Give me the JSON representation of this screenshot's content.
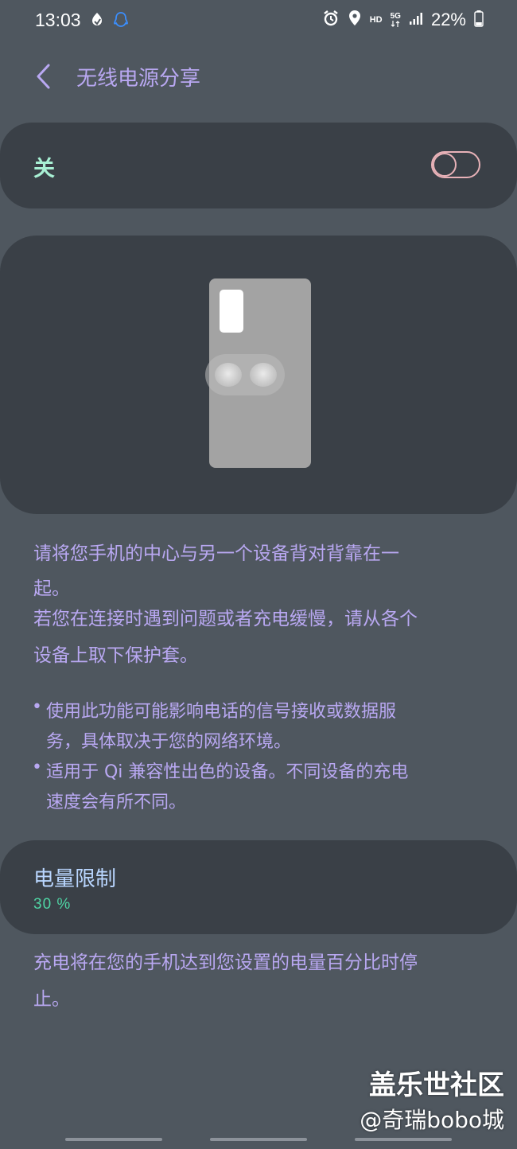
{
  "status_bar": {
    "time": "13:03",
    "left_icons": [
      "bixby-routine-icon",
      "qq-icon"
    ],
    "right_icons": [
      "alarm-icon",
      "location-icon",
      "hd-icon",
      "5g-icon",
      "signal-icon",
      "battery-icon"
    ],
    "hd_label": "HD",
    "network_label": "5G",
    "battery_percent": "22%"
  },
  "header": {
    "title": "无线电源分享"
  },
  "toggle": {
    "label": "关",
    "state": "off",
    "accent_color": "#e8b2b8"
  },
  "description": {
    "lines": [
      "请将您手机的中心与另一个设备背对背靠在一",
      "起。",
      "若您在连接时遇到问题或者充电缓慢，请从各个",
      "设备上取下保护套。"
    ]
  },
  "notes": {
    "bullet": "•",
    "items": [
      {
        "lines": [
          "使用此功能可能影响电话的信号接收或数据服",
          "务，具体取决于您的网络环境。"
        ]
      },
      {
        "lines": [
          "适用于 Qi 兼容性出色的设备。不同设备的充电",
          "速度会有所不同。"
        ]
      }
    ]
  },
  "power_limit": {
    "title": "电量限制",
    "value": "30 %"
  },
  "limit_description": {
    "lines": [
      "充电将在您的手机达到您设置的电量百分比时停",
      "止。"
    ]
  },
  "watermark": {
    "line1": "盖乐世社区",
    "line2": "@奇瑞bobo城"
  },
  "colors": {
    "background": "#4f575f",
    "card": "#3a4047",
    "text_purple": "#b9a8f2",
    "toggle_label": "#a8f0d4",
    "limit_value": "#4fd4a4"
  }
}
